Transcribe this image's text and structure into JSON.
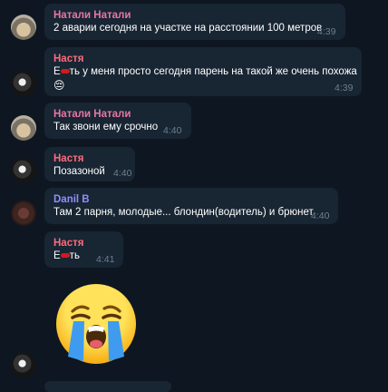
{
  "messages": [
    {
      "sender": "Натали Натали",
      "text": "2 аварии сегодня на участке на расстоянии 100 метров",
      "time": "4:39"
    },
    {
      "sender": "Настя",
      "text_prefix": "Е",
      "text": "ть у меня просто сегодня парень на такой же очень похожа",
      "text2": "😔",
      "time": "4:39"
    },
    {
      "sender": "Натали Натали",
      "text": "Так звони ему срочно",
      "time": "4:40"
    },
    {
      "sender": "Настя",
      "text": "Позазоной",
      "time": "4:40"
    },
    {
      "sender": "Danil B",
      "text": "Там 2 парня, молодые... блондин(водитель)  и брюнет",
      "time": "4:40"
    },
    {
      "sender": "Настя",
      "text_prefix": "Е",
      "text": "ть",
      "time": "4:41"
    }
  ],
  "icons": {
    "reaction_emoji": "loudly-crying-face-icon",
    "avatar_natali": "avatar",
    "avatar_nastya": "avatar",
    "avatar_danil": "avatar"
  },
  "colors": {
    "background": "#0e1621",
    "bubble": "#182533",
    "natali": "#e577a3",
    "nastya": "#ff6b7c",
    "danil": "#8f8ffb",
    "time": "#6d7f8f"
  }
}
